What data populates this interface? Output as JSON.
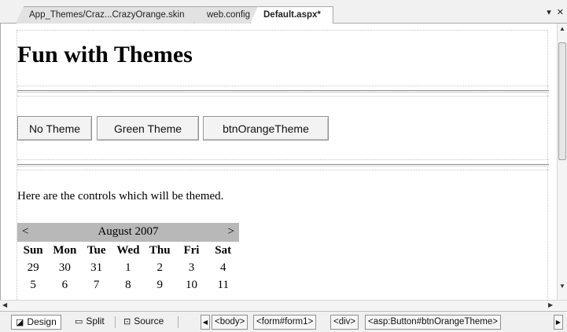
{
  "tabs": [
    {
      "label": "App_Themes/Craz...CrazyOrange.skin"
    },
    {
      "label": "web.config"
    },
    {
      "label": "Default.aspx*"
    }
  ],
  "tab_tools": {
    "dropdown": "▾",
    "close": "✕"
  },
  "page": {
    "title": "Fun with Themes",
    "buttons": [
      {
        "label": "No Theme"
      },
      {
        "label": "Green Theme"
      },
      {
        "label": "btnOrangeTheme"
      }
    ],
    "intro": "Here are the controls which will be themed."
  },
  "calendar": {
    "prev": "<",
    "next": ">",
    "month": "August 2007",
    "day_headers": [
      "Sun",
      "Mon",
      "Tue",
      "Wed",
      "Thu",
      "Fri",
      "Sat"
    ],
    "weeks": [
      [
        "29",
        "30",
        "31",
        "1",
        "2",
        "3",
        "4"
      ],
      [
        "5",
        "6",
        "7",
        "8",
        "9",
        "10",
        "11"
      ]
    ]
  },
  "view_bar": {
    "design": "Design",
    "split": "Split",
    "source": "Source",
    "crumbs": [
      "<body>",
      "<form#form1>",
      "<div>",
      "<asp:Button#btnOrangeTheme>"
    ]
  }
}
